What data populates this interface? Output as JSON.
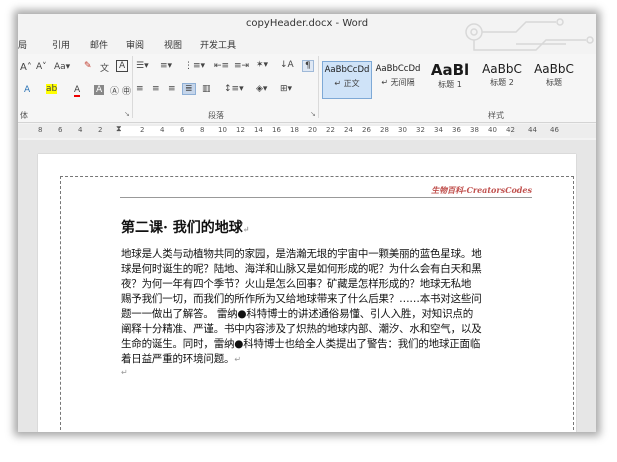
{
  "window": {
    "title": "copyHeader.docx - Word"
  },
  "menu": [
    "局",
    "引用",
    "邮件",
    "审阅",
    "视图",
    "开发工具"
  ],
  "ribbon": {
    "font_row1": [
      "A˄",
      "A˅",
      "Aa▾",
      "A"
    ],
    "font_row2": [
      "A",
      "A",
      "A",
      "Ⓐ",
      "㊥"
    ],
    "paragraph_group_label": "段落",
    "styles_group_label": "样式",
    "styles": [
      {
        "sample": "AaBbCcDd",
        "name": "↵ 正文",
        "selected": true
      },
      {
        "sample": "AaBbCcDd",
        "name": "↵ 无间隔",
        "selected": false
      },
      {
        "sample": "AaBl",
        "name": "标题 1",
        "selected": false
      },
      {
        "sample": "AaBbC",
        "name": "标题 2",
        "selected": false
      },
      {
        "sample": "AaBbC",
        "name": "标题",
        "selected": false
      }
    ]
  },
  "ruler": [
    "8",
    "6",
    "4",
    "2",
    "2",
    "4",
    "6",
    "8",
    "10",
    "12",
    "14",
    "16",
    "18",
    "20",
    "22",
    "24",
    "26",
    "28",
    "30",
    "32",
    "34",
    "36",
    "38",
    "40",
    "42",
    "44",
    "46"
  ],
  "document": {
    "header_text": "生物百科-CreatorsCodes",
    "heading": "第二课· 我们的地球",
    "body_lines": [
      "地球是人类与动植物共同的家园，是浩瀚无垠的宇宙中一颗美丽的蓝色星球。地",
      "球是何时诞生的呢？陆地、海洋和山脉又是如何形成的呢？为什么会有白天和黑",
      "夜？为何一年有四个季节？火山是怎么回事？矿藏是怎样形成的？地球无私地",
      "赐予我们一切，而我们的所作所为又给地球带来了什么后果？……本书对这些问",
      "题一一做出了解答。 雷纳●科特博士的讲述通俗易懂、引人入胜，对知识点的",
      "阐释十分精准、严谨。书中内容涉及了炽热的地球内部、潮汐、水和空气，以及",
      "生命的诞生。同时，雷纳●科特博士也给全人类提出了警告：我们的地球正面临",
      "着日益严重的环境问题。"
    ]
  }
}
